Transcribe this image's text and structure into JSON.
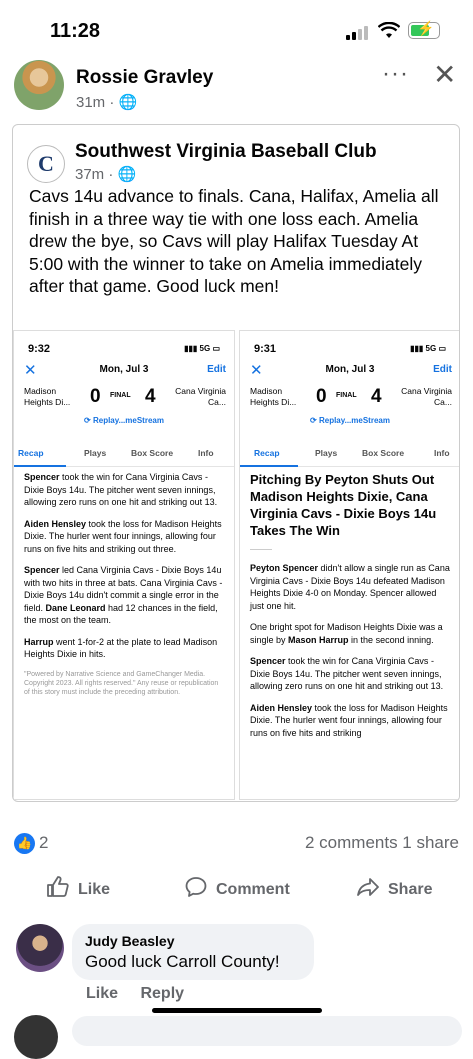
{
  "status_bar": {
    "time": "11:28"
  },
  "post": {
    "author": "Rossie Gravley",
    "time": "31m",
    "more_label": "···",
    "close_label": "✕",
    "shared": {
      "page_name": "Southwest Virginia Baseball Club",
      "time": "37m",
      "text": "Cavs 14u advance to finals.  Cana, Halifax, Amelia all finish in a three way tie with one loss each.  Amelia drew the bye, so Cavs will play Halifax Tuesday At 5:00 with the winner to take on Amelia immediately after that game.  Good luck men!",
      "screenshots": [
        {
          "time": "9:32",
          "signal": "5G",
          "date": "Mon, Jul 3",
          "edit": "Edit",
          "team_left": "Madison Heights Di...",
          "score_left": "0",
          "status": "FINAL",
          "score_right": "4",
          "team_right": "Cana Virginia Ca...",
          "replay": "Replay...meStream",
          "tabs": [
            "Recap",
            "Plays",
            "Box Score",
            "Info"
          ],
          "p1_bold": "Spencer",
          "p1": " took the win for Cana Virginia Cavs - Dixie Boys 14u. The pitcher went seven innings, allowing zero runs on one hit and striking out 13.",
          "p2_bold": "Aiden Hensley",
          "p2": " took the loss for Madison Heights Dixie. The hurler went four innings, allowing four runs on five hits and striking out three.",
          "p3_bold": "Spencer",
          "p3": " led Cana Virginia Cavs - Dixie Boys 14u with two hits in three at bats.  Cana Virginia Cavs - Dixie Boys 14u didn't commit a single error in the field. ",
          "p3_bold2": "Dane Leonard",
          "p3b": " had  12 chances in the field, the most on the team.",
          "p4_bold": "Harrup",
          "p4": " went 1-for-2 at the plate to lead Madison Heights Dixie in hits.",
          "footer": "\"Powered by Narrative Science and GameChanger Media. Copyright 2023. All rights reserved.\" Any reuse or republication of this story must include the preceding attribution."
        },
        {
          "time": "9:31",
          "signal": "5G",
          "date": "Mon, Jul 3",
          "edit": "Edit",
          "team_left": "Madison Heights Di...",
          "score_left": "0",
          "status": "FINAL",
          "score_right": "4",
          "team_right": "Cana Virginia Ca...",
          "replay": "Replay...meStream",
          "tabs": [
            "Recap",
            "Plays",
            "Box Score",
            "Info"
          ],
          "headline": "Pitching By Peyton Shuts Out Madison Heights Dixie, Cana Virginia Cavs - Dixie Boys 14u Takes The Win",
          "p1_bold": "Peyton Spencer",
          "p1": " didn't allow a single run as Cana Virginia Cavs - Dixie Boys 14u defeated Madison Heights Dixie 4-0 on Monday. Spencer allowed just one hit.",
          "p2": "One bright spot for Madison Heights Dixie was a single by ",
          "p2_bold": "Mason Harrup",
          "p2b": " in the second inning.",
          "p3_bold": "Spencer",
          "p3": " took the win for Cana Virginia Cavs - Dixie Boys 14u. The pitcher went seven innings, allowing zero runs on one hit and striking out 13.",
          "p4_bold": "Aiden Hensley",
          "p4": " took the loss for Madison Heights Dixie. The hurler went four innings, allowing four runs on five hits and striking"
        }
      ]
    },
    "reaction_count": "2",
    "stats": "2 comments  1 share",
    "actions": {
      "like": "Like",
      "comment": "Comment",
      "share": "Share"
    }
  },
  "comment": {
    "name": "Judy Beasley",
    "text": "Good luck Carroll County!",
    "like": "Like",
    "reply": "Reply"
  },
  "colors": {
    "accent": "#1877f2",
    "gamechanger_blue": "#1572e0"
  }
}
